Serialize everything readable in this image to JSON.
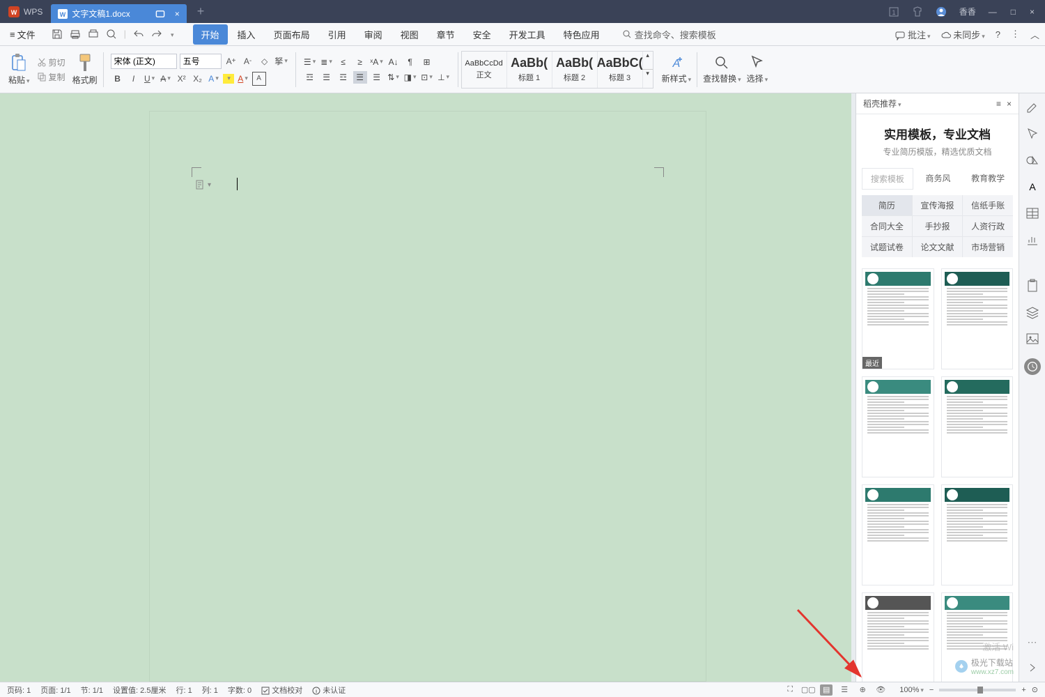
{
  "titlebar": {
    "app": "WPS",
    "tab_filename": "文字文稿1.docx",
    "username": "香香"
  },
  "menu": {
    "file": "文件",
    "tabs": [
      "开始",
      "插入",
      "页面布局",
      "引用",
      "审阅",
      "视图",
      "章节",
      "安全",
      "开发工具",
      "特色应用"
    ],
    "active_tab": "开始",
    "search": "查找命令、搜索模板",
    "comment": "批注",
    "sync": "未同步"
  },
  "ribbon": {
    "paste": "粘贴",
    "cut": "剪切",
    "copy": "复制",
    "format_painter": "格式刷",
    "font_name": "宋体 (正文)",
    "font_size": "五号",
    "styles": [
      {
        "preview": "AaBbCcDd",
        "name": "正文",
        "big": false
      },
      {
        "preview": "AaBb(",
        "name": "标题 1",
        "big": true
      },
      {
        "preview": "AaBb(",
        "name": "标题 2",
        "big": true
      },
      {
        "preview": "AaBbC(",
        "name": "标题 3",
        "big": true
      }
    ],
    "new_style": "新样式",
    "find_replace": "查找替换",
    "select": "选择"
  },
  "panel": {
    "header": "稻壳推荐",
    "title": "实用模板，专业文档",
    "subtitle": "专业简历模版，精选优质文档",
    "search_placeholder": "搜索模板",
    "tabs": [
      "商务风",
      "教育教学"
    ],
    "categories": [
      "简历",
      "宣传海报",
      "信纸手账",
      "合同大全",
      "手抄报",
      "人资行政",
      "试题试卷",
      "论文文献",
      "市场营销"
    ],
    "recent_badge": "最近"
  },
  "status": {
    "page_num": "页码: 1",
    "page": "页面: 1/1",
    "section": "节: 1/1",
    "setting": "设置值: 2.5厘米",
    "row": "行: 1",
    "col": "列: 1",
    "words": "字数: 0",
    "proofing": "文档校对",
    "cert": "未认证",
    "zoom": "100%"
  },
  "watermark": {
    "line1": "激活 Wi",
    "brand": "极光下载站",
    "url": "www.xz7.com"
  }
}
